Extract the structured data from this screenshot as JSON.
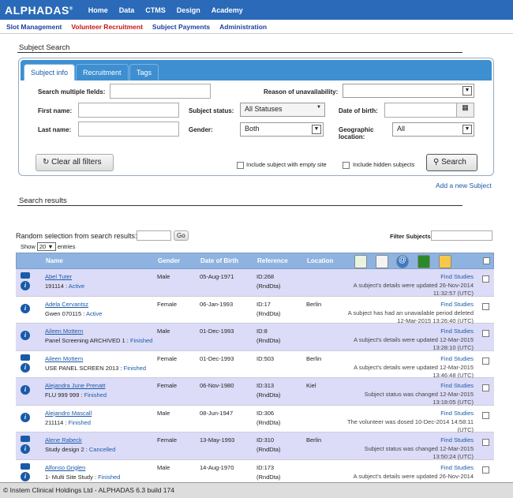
{
  "app": {
    "logo": "ALPHADAS",
    "logo_mark": "®"
  },
  "topnav": [
    "Home",
    "Data",
    "CTMS",
    "Design",
    "Academy"
  ],
  "subnav": [
    "Slot Management",
    "Volunteer Recruitment",
    "Subject Payments",
    "Administration"
  ],
  "search": {
    "title": "Subject Search",
    "tabs": [
      "Subject info",
      "Recruitment",
      "Tags"
    ],
    "labels": {
      "multi": "Search multiple fields:",
      "reason": "Reason of unavailability:",
      "first": "First name:",
      "status": "Subject status:",
      "dob": "Date of birth:",
      "last": "Last name:",
      "gender": "Gender:",
      "geo": "Geographic location:"
    },
    "values": {
      "status": "All Statuses",
      "gender": "Both",
      "geo": "All"
    },
    "clear": "Clear all filters",
    "empty_site": "Include subject with empty site",
    "hidden": "Include hidden subjects",
    "search_btn": "Search",
    "add": "Add a new Subject"
  },
  "results": {
    "title": "Search results",
    "random": "Random selection from search results:",
    "go": "Go",
    "filter": "Filter Subjects:",
    "show": "Show",
    "show_val": "20",
    "entries": "entries",
    "headers": {
      "name": "Name",
      "gender": "Gender",
      "dob": "Date of Birth",
      "ref": "Reference",
      "loc": "Location"
    },
    "rows": [
      {
        "name": "Abel Tuter",
        "sub": "191114",
        "status": "Active",
        "gender": "Male",
        "dob": "05-Aug-1971",
        "ref": "ID:268",
        "ref2": "(RndDta)",
        "loc": "",
        "link": "Find Studies",
        "msg": "A subject's details were updated 26-Nov-2014",
        "time": "11:32:57 (UTC)",
        "chat": true
      },
      {
        "name": "Adela Cervantsz",
        "sub": "Gwen 070115",
        "status": "Active",
        "gender": "Female",
        "dob": "06-Jan-1993",
        "ref": "ID:17",
        "ref2": "(RndDta)",
        "loc": "Berlin",
        "link": "Find Studies",
        "msg": "A subject has had an unavailable period deleted",
        "time": "12-Mar-2015 13:26:40 (UTC)",
        "chat": false
      },
      {
        "name": "Aileen Mottern",
        "sub": "Panel Screening ARCHIVED 1",
        "status": "Finished",
        "gender": "Male",
        "dob": "01-Dec-1993",
        "ref": "ID:8",
        "ref2": "(RndDta)",
        "loc": "",
        "link": "Find Studies",
        "msg": "A subject's details were updated 12-Mar-2015",
        "time": "13:28:10 (UTC)",
        "chat": false
      },
      {
        "name": "Aileen Mottern",
        "sub": "USE PANEL SCREEN 2013",
        "status": "Finished",
        "gender": "Female",
        "dob": "01-Dec-1993",
        "ref": "ID:503",
        "ref2": "",
        "loc": "Berlin",
        "link": "Find Studies",
        "msg": "A subject's details were updated 12-Mar-2015",
        "time": "13:46:48 (UTC)",
        "chat": true
      },
      {
        "name": "Alejandra June Prenatt",
        "sub": "FLU 999 999",
        "status": "Finished",
        "gender": "Female",
        "dob": "06-Nov-1980",
        "ref": "ID:313",
        "ref2": "(RndDta)",
        "loc": "Kiel",
        "link": "Find Studies",
        "msg": "Subject status was changed 12-Mar-2015",
        "time": "13:18:05 (UTC)",
        "chat": false
      },
      {
        "name": "Alejandro Mascall",
        "sub": "211114",
        "status": "Finished",
        "gender": "Male",
        "dob": "08-Jun-1947",
        "ref": "ID:306",
        "ref2": "(RndDta)",
        "loc": "",
        "link": "Find Studies",
        "msg": "The volunteer was dosed 10-Dec-2014 14:58:11",
        "time": "(UTC)",
        "chat": false
      },
      {
        "name": "Alene Rabeck",
        "sub": "Study design 2",
        "status": "Cancelled",
        "gender": "Female",
        "dob": "13-May-1993",
        "ref": "ID:310",
        "ref2": "(RndDta)",
        "loc": "Berlin",
        "link": "Find Studies",
        "msg": "Subject status was changed 12-Mar-2015",
        "time": "13:50:24 (UTC)",
        "chat": true
      },
      {
        "name": "Alfonso Griglen",
        "sub": "1- Multi Site Study",
        "status": "Finished",
        "gender": "Male",
        "dob": "14-Aug-1970",
        "ref": "ID:173",
        "ref2": "(RndDta)",
        "loc": "",
        "link": "Find Studies",
        "msg": "A subject's details were updated 26-Nov-2014",
        "time": "",
        "chat": true
      }
    ]
  },
  "footer": "© Instem Clinical Holdings Ltd - ALPHADAS 6.3 build 174"
}
